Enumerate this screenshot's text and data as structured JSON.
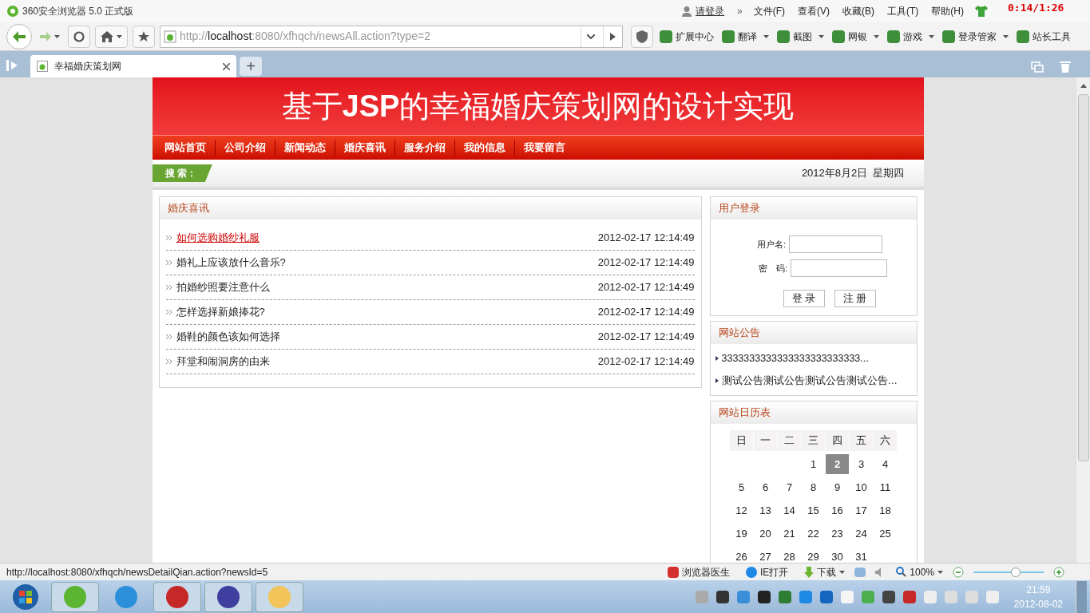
{
  "browser": {
    "title": "360安全浏览器 5.0 正式版",
    "login_link": "请登录",
    "more": "»",
    "menu": [
      "文件(F)",
      "查看(V)",
      "收藏(B)",
      "工具(T)",
      "帮助(H)"
    ],
    "timer": "0:14/1:26",
    "address": {
      "host": "localhost",
      "url_before": "http://",
      "url_after": ":8080/xfhqch/newsAll.action?type=2"
    },
    "tools": [
      {
        "label": "扩展中心",
        "dropdown": false
      },
      {
        "label": "翻译",
        "dropdown": true
      },
      {
        "label": "截图",
        "dropdown": true
      },
      {
        "label": "网银",
        "dropdown": true
      },
      {
        "label": "游戏",
        "dropdown": true
      },
      {
        "label": "登录管家",
        "dropdown": true
      },
      {
        "label": "站长工具",
        "dropdown": false
      }
    ],
    "tabs": [
      {
        "title": "幸福婚庆策划网",
        "selected": true
      }
    ],
    "new_tab": "+"
  },
  "page": {
    "title_pre": "基于",
    "title_bold": "JSP",
    "title_post": "的幸福婚庆策划网的设计实现",
    "nav": [
      {
        "label": "网站首页"
      },
      {
        "label": "公司介绍"
      },
      {
        "label": "新闻动态"
      },
      {
        "label": "婚庆喜讯"
      },
      {
        "label": "服务介绍"
      },
      {
        "label": "我的信息"
      },
      {
        "label": "我要留言"
      }
    ],
    "search_label": "搜 索：",
    "date": "2012年8月2日  星期四",
    "news": {
      "title": "婚庆喜讯",
      "items": [
        {
          "title": "如何选购婚纱礼服",
          "date": "2012-02-17 12:14:49",
          "hovered": true
        },
        {
          "title": "婚礼上应该放什么音乐?",
          "date": "2012-02-17 12:14:49",
          "hovered": false
        },
        {
          "title": "拍婚纱照要注意什么",
          "date": "2012-02-17 12:14:49",
          "hovered": false
        },
        {
          "title": "怎样选择新娘捧花?",
          "date": "2012-02-17 12:14:49",
          "hovered": false
        },
        {
          "title": "婚鞋的颜色该如何选择",
          "date": "2012-02-17 12:14:49",
          "hovered": false
        },
        {
          "title": "拜堂和闹洞房的由来",
          "date": "2012-02-17 12:14:49",
          "hovered": false
        }
      ]
    },
    "login": {
      "title": "用户登录",
      "username_label": "用户名:",
      "password_label": "密　码:",
      "buttons": [
        "登 录",
        "注 册"
      ]
    },
    "notices": {
      "title": "网站公告",
      "items": [
        "3333333333333333333333333...",
        "测试公告测试公告测试公告测试公告…"
      ]
    },
    "calendar": {
      "title": "网站日历表",
      "weekdays": [
        "日",
        "一",
        "二",
        "三",
        "四",
        "五",
        "六"
      ],
      "weeks": [
        [
          {
            "day": "1",
            "selected": false
          },
          {
            "day": "2",
            "selected": true
          },
          {
            "day": "3",
            "selected": false
          },
          {
            "day": "4",
            "selected": false
          }
        ],
        [
          {
            "day": "5",
            "selected": false
          },
          {
            "day": "6",
            "selected": false
          },
          {
            "day": "7",
            "selected": false
          },
          {
            "day": "8",
            "selected": false
          },
          {
            "day": "9",
            "selected": false
          },
          {
            "day": "10",
            "selected": false
          },
          {
            "day": "11",
            "selected": false
          }
        ],
        [
          {
            "day": "12",
            "selected": false
          },
          {
            "day": "13",
            "selected": false
          },
          {
            "day": "14",
            "selected": false
          },
          {
            "day": "15",
            "selected": false
          },
          {
            "day": "16",
            "selected": false
          },
          {
            "day": "17",
            "selected": false
          },
          {
            "day": "18",
            "selected": false
          }
        ],
        [
          {
            "day": "19",
            "selected": false
          },
          {
            "day": "20",
            "selected": false
          },
          {
            "day": "21",
            "selected": false
          },
          {
            "day": "22",
            "selected": false
          },
          {
            "day": "23",
            "selected": false
          },
          {
            "day": "24",
            "selected": false
          },
          {
            "day": "25",
            "selected": false
          }
        ],
        [
          {
            "day": "26",
            "selected": false
          },
          {
            "day": "27",
            "selected": false
          },
          {
            "day": "28",
            "selected": false
          },
          {
            "day": "29",
            "selected": false
          },
          {
            "day": "30",
            "selected": false
          },
          {
            "day": "31",
            "selected": false
          }
        ]
      ]
    }
  },
  "status_bar": {
    "url": "http://localhost:8080/xfhqch/newsDetailQian.action?newsId=5",
    "doctor": "浏览器医生",
    "ie": "IE打开",
    "download": "下载",
    "zoom": "100%",
    "zoom_slider": {
      "level": 0.6
    }
  },
  "taskbar": {
    "time": "21:59",
    "date": "2012-08-02"
  }
}
